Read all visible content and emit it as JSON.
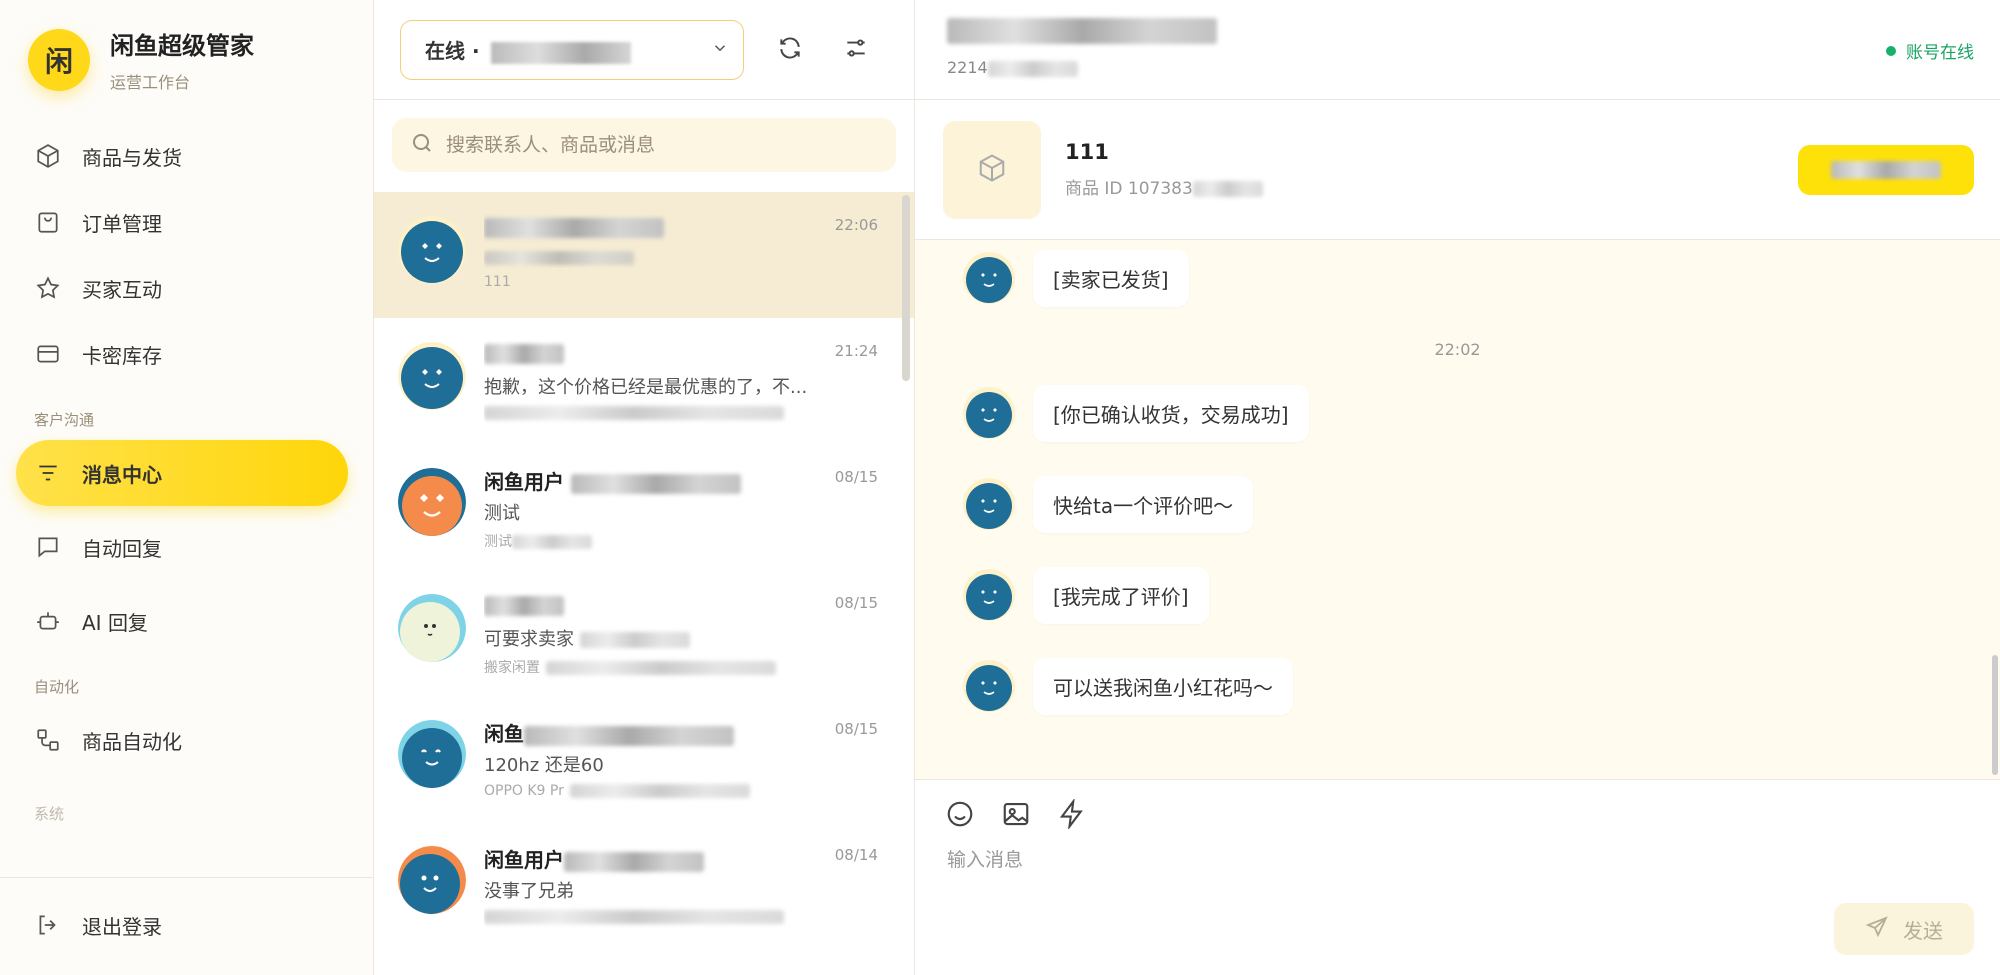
{
  "brand": {
    "logo_char": "闲",
    "title": "闲鱼超级管家",
    "subtitle": "运营工作台"
  },
  "sidebar": {
    "items": [
      {
        "label": "商品与发货",
        "icon": "box-icon"
      },
      {
        "label": "订单管理",
        "icon": "bag-icon"
      },
      {
        "label": "买家互动",
        "icon": "star-icon"
      },
      {
        "label": "卡密库存",
        "icon": "card-icon"
      }
    ],
    "section_comm": "客户沟通",
    "comm_items": [
      {
        "label": "消息中心",
        "icon": "filter-lines-icon",
        "active": true
      },
      {
        "label": "自动回复",
        "icon": "chat-bubble-icon"
      },
      {
        "label": "AI 回复",
        "icon": "robot-icon"
      }
    ],
    "section_auto": "自动化",
    "auto_items": [
      {
        "label": "商品自动化",
        "icon": "flow-icon"
      }
    ],
    "section_sys": "系统",
    "logout": "退出登录"
  },
  "conv_list": {
    "status_label": "在线 · ",
    "search_placeholder": "搜索联系人、商品或消息",
    "items": [
      {
        "name": "",
        "msg": "",
        "sub": "111",
        "time": "22:06",
        "active": true
      },
      {
        "name": "",
        "msg": "抱歉，这个价格已经是最优惠的了，不...",
        "sub": "",
        "time": "21:24"
      },
      {
        "name": "闲鱼用户",
        "msg": "测试",
        "sub": "测试",
        "time": "08/15"
      },
      {
        "name": "",
        "msg": "可要求卖家",
        "sub": "搬家闲置",
        "time": "08/15"
      },
      {
        "name": "闲鱼",
        "msg": "120hz 还是60",
        "sub": "OPPO K9 Pr",
        "time": "08/15"
      },
      {
        "name": "闲鱼用户",
        "msg": "没事了兄弟",
        "sub": "",
        "time": "08/14"
      }
    ]
  },
  "chat": {
    "id_prefix": "2214",
    "online_label": "账号在线",
    "product": {
      "name": "111",
      "id_label": "商品 ID 107383"
    },
    "messages": [
      {
        "text": "[卖家已发货]"
      },
      {
        "time": "22:02"
      },
      {
        "text": "[你已确认收货，交易成功]"
      },
      {
        "text": "快给ta一个评价吧～"
      },
      {
        "text": "[我完成了评价]"
      },
      {
        "text": "可以送我闲鱼小红花吗～"
      }
    ],
    "input_placeholder": "输入消息",
    "send_label": "发送"
  },
  "colors": {
    "accent": "#ffd60a",
    "online": "#19a463",
    "avatar_blue": "#1f6e97",
    "avatar_orange": "#f58b4a"
  }
}
